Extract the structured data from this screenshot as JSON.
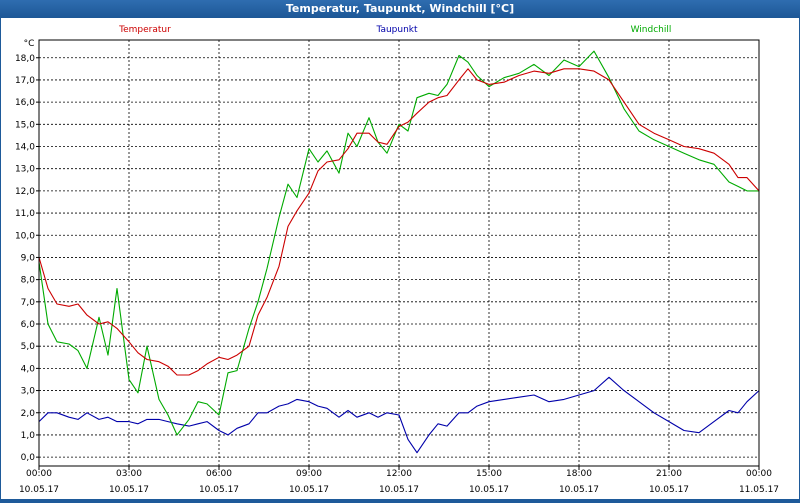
{
  "window": {
    "title": "Temperatur, Taupunkt, Windchill [°C]"
  },
  "chart_data": {
    "type": "line",
    "title": "Temperatur, Taupunkt, Windchill [°C]",
    "ylabel": "°C",
    "ylim": [
      -0.4,
      18.8
    ],
    "yticks": [
      0,
      1,
      2,
      3,
      4,
      5,
      6,
      7,
      8,
      9,
      10,
      11,
      12,
      13,
      14,
      15,
      16,
      17,
      18
    ],
    "ytick_labels": [
      "0,0",
      "1,0",
      "2,0",
      "3,0",
      "4,0",
      "5,0",
      "6,0",
      "7,0",
      "8,0",
      "9,0",
      "10,0",
      "11,0",
      "12,0",
      "13,0",
      "14,0",
      "15,0",
      "16,0",
      "17,0",
      "18,0"
    ],
    "xlim": [
      0,
      24
    ],
    "xticks": [
      {
        "time": "00:00",
        "date": "10.05.17"
      },
      {
        "time": "03:00",
        "date": "10.05.17"
      },
      {
        "time": "06:00",
        "date": "10.05.17"
      },
      {
        "time": "09:00",
        "date": "10.05.17"
      },
      {
        "time": "12:00",
        "date": "10.05.17"
      },
      {
        "time": "15:00",
        "date": "10.05.17"
      },
      {
        "time": "18:00",
        "date": "10.05.17"
      },
      {
        "time": "21:00",
        "date": "10.05.17"
      },
      {
        "time": "00:00",
        "date": "11.05.17"
      }
    ],
    "grid": true,
    "legend": "top",
    "series": [
      {
        "name": "Temperatur",
        "color": "#cc0000",
        "points": [
          [
            0,
            9.0
          ],
          [
            0.3,
            7.6
          ],
          [
            0.6,
            6.9
          ],
          [
            1.0,
            6.8
          ],
          [
            1.3,
            6.9
          ],
          [
            1.6,
            6.4
          ],
          [
            2.0,
            6.0
          ],
          [
            2.3,
            6.1
          ],
          [
            2.6,
            5.8
          ],
          [
            3.0,
            5.2
          ],
          [
            3.3,
            4.7
          ],
          [
            3.6,
            4.4
          ],
          [
            4.0,
            4.3
          ],
          [
            4.3,
            4.1
          ],
          [
            4.6,
            3.7
          ],
          [
            5.0,
            3.7
          ],
          [
            5.3,
            3.9
          ],
          [
            5.6,
            4.2
          ],
          [
            6.0,
            4.5
          ],
          [
            6.3,
            4.4
          ],
          [
            6.6,
            4.6
          ],
          [
            7.0,
            5.0
          ],
          [
            7.3,
            6.4
          ],
          [
            7.6,
            7.2
          ],
          [
            8.0,
            8.6
          ],
          [
            8.3,
            10.4
          ],
          [
            8.6,
            11.1
          ],
          [
            9.0,
            11.9
          ],
          [
            9.3,
            12.9
          ],
          [
            9.6,
            13.3
          ],
          [
            10.0,
            13.4
          ],
          [
            10.3,
            13.9
          ],
          [
            10.6,
            14.6
          ],
          [
            11.0,
            14.6
          ],
          [
            11.3,
            14.2
          ],
          [
            11.6,
            14.1
          ],
          [
            12.0,
            14.9
          ],
          [
            12.3,
            15.1
          ],
          [
            12.6,
            15.5
          ],
          [
            13.0,
            16.0
          ],
          [
            13.3,
            16.2
          ],
          [
            13.6,
            16.3
          ],
          [
            14.0,
            17.0
          ],
          [
            14.3,
            17.5
          ],
          [
            14.6,
            17.0
          ],
          [
            15.0,
            16.8
          ],
          [
            15.5,
            16.9
          ],
          [
            16.0,
            17.2
          ],
          [
            16.5,
            17.4
          ],
          [
            17.0,
            17.3
          ],
          [
            17.5,
            17.5
          ],
          [
            18.0,
            17.5
          ],
          [
            18.5,
            17.4
          ],
          [
            19.0,
            17.0
          ],
          [
            19.5,
            16.0
          ],
          [
            20.0,
            15.0
          ],
          [
            20.5,
            14.6
          ],
          [
            21.0,
            14.3
          ],
          [
            21.5,
            14.0
          ],
          [
            22.0,
            13.9
          ],
          [
            22.5,
            13.7
          ],
          [
            23.0,
            13.2
          ],
          [
            23.3,
            12.6
          ],
          [
            23.6,
            12.6
          ],
          [
            24.0,
            12.0
          ]
        ]
      },
      {
        "name": "Taupunkt",
        "color": "#0000aa",
        "points": [
          [
            0,
            1.6
          ],
          [
            0.3,
            2.0
          ],
          [
            0.6,
            2.0
          ],
          [
            1.0,
            1.8
          ],
          [
            1.3,
            1.7
          ],
          [
            1.6,
            2.0
          ],
          [
            2.0,
            1.7
          ],
          [
            2.3,
            1.8
          ],
          [
            2.6,
            1.6
          ],
          [
            3.0,
            1.6
          ],
          [
            3.3,
            1.5
          ],
          [
            3.6,
            1.7
          ],
          [
            4.0,
            1.7
          ],
          [
            4.3,
            1.6
          ],
          [
            4.6,
            1.5
          ],
          [
            5.0,
            1.4
          ],
          [
            5.3,
            1.5
          ],
          [
            5.6,
            1.6
          ],
          [
            6.0,
            1.2
          ],
          [
            6.3,
            1.0
          ],
          [
            6.6,
            1.3
          ],
          [
            7.0,
            1.5
          ],
          [
            7.3,
            2.0
          ],
          [
            7.6,
            2.0
          ],
          [
            8.0,
            2.3
          ],
          [
            8.3,
            2.4
          ],
          [
            8.6,
            2.6
          ],
          [
            9.0,
            2.5
          ],
          [
            9.3,
            2.3
          ],
          [
            9.6,
            2.2
          ],
          [
            10.0,
            1.8
          ],
          [
            10.3,
            2.1
          ],
          [
            10.6,
            1.8
          ],
          [
            11.0,
            2.0
          ],
          [
            11.3,
            1.8
          ],
          [
            11.6,
            2.0
          ],
          [
            12.0,
            1.9
          ],
          [
            12.3,
            0.8
          ],
          [
            12.6,
            0.2
          ],
          [
            13.0,
            1.0
          ],
          [
            13.3,
            1.5
          ],
          [
            13.6,
            1.4
          ],
          [
            14.0,
            2.0
          ],
          [
            14.3,
            2.0
          ],
          [
            14.6,
            2.3
          ],
          [
            15.0,
            2.5
          ],
          [
            15.5,
            2.6
          ],
          [
            16.0,
            2.7
          ],
          [
            16.5,
            2.8
          ],
          [
            17.0,
            2.5
          ],
          [
            17.5,
            2.6
          ],
          [
            18.0,
            2.8
          ],
          [
            18.5,
            3.0
          ],
          [
            19.0,
            3.6
          ],
          [
            19.5,
            3.0
          ],
          [
            20.0,
            2.5
          ],
          [
            20.5,
            2.0
          ],
          [
            21.0,
            1.6
          ],
          [
            21.5,
            1.2
          ],
          [
            22.0,
            1.1
          ],
          [
            22.5,
            1.6
          ],
          [
            23.0,
            2.1
          ],
          [
            23.3,
            2.0
          ],
          [
            23.6,
            2.5
          ],
          [
            24.0,
            3.0
          ]
        ]
      },
      {
        "name": "Windchill",
        "color": "#00aa00",
        "points": [
          [
            0,
            8.8
          ],
          [
            0.3,
            6.0
          ],
          [
            0.6,
            5.2
          ],
          [
            1.0,
            5.1
          ],
          [
            1.3,
            4.8
          ],
          [
            1.6,
            4.0
          ],
          [
            2.0,
            6.3
          ],
          [
            2.3,
            4.6
          ],
          [
            2.6,
            7.6
          ],
          [
            3.0,
            3.5
          ],
          [
            3.3,
            2.9
          ],
          [
            3.6,
            5.0
          ],
          [
            4.0,
            2.6
          ],
          [
            4.3,
            1.9
          ],
          [
            4.6,
            1.0
          ],
          [
            5.0,
            1.7
          ],
          [
            5.3,
            2.5
          ],
          [
            5.6,
            2.4
          ],
          [
            6.0,
            1.9
          ],
          [
            6.3,
            3.8
          ],
          [
            6.6,
            3.9
          ],
          [
            7.0,
            5.8
          ],
          [
            7.3,
            7.0
          ],
          [
            7.6,
            8.5
          ],
          [
            8.0,
            10.8
          ],
          [
            8.3,
            12.3
          ],
          [
            8.6,
            11.7
          ],
          [
            9.0,
            13.9
          ],
          [
            9.3,
            13.3
          ],
          [
            9.6,
            13.8
          ],
          [
            10.0,
            12.8
          ],
          [
            10.3,
            14.6
          ],
          [
            10.6,
            14.0
          ],
          [
            11.0,
            15.3
          ],
          [
            11.3,
            14.2
          ],
          [
            11.6,
            13.7
          ],
          [
            12.0,
            15.0
          ],
          [
            12.3,
            14.7
          ],
          [
            12.6,
            16.2
          ],
          [
            13.0,
            16.4
          ],
          [
            13.3,
            16.3
          ],
          [
            13.6,
            16.8
          ],
          [
            14.0,
            18.1
          ],
          [
            14.3,
            17.8
          ],
          [
            14.6,
            17.2
          ],
          [
            15.0,
            16.7
          ],
          [
            15.5,
            17.1
          ],
          [
            16.0,
            17.3
          ],
          [
            16.5,
            17.7
          ],
          [
            17.0,
            17.2
          ],
          [
            17.5,
            17.9
          ],
          [
            18.0,
            17.6
          ],
          [
            18.5,
            18.3
          ],
          [
            19.0,
            17.1
          ],
          [
            19.5,
            15.7
          ],
          [
            20.0,
            14.7
          ],
          [
            20.5,
            14.3
          ],
          [
            21.0,
            14.0
          ],
          [
            21.5,
            13.7
          ],
          [
            22.0,
            13.4
          ],
          [
            22.5,
            13.2
          ],
          [
            23.0,
            12.4
          ],
          [
            23.3,
            12.2
          ],
          [
            23.6,
            12.0
          ],
          [
            24.0,
            12.0
          ]
        ]
      }
    ]
  }
}
